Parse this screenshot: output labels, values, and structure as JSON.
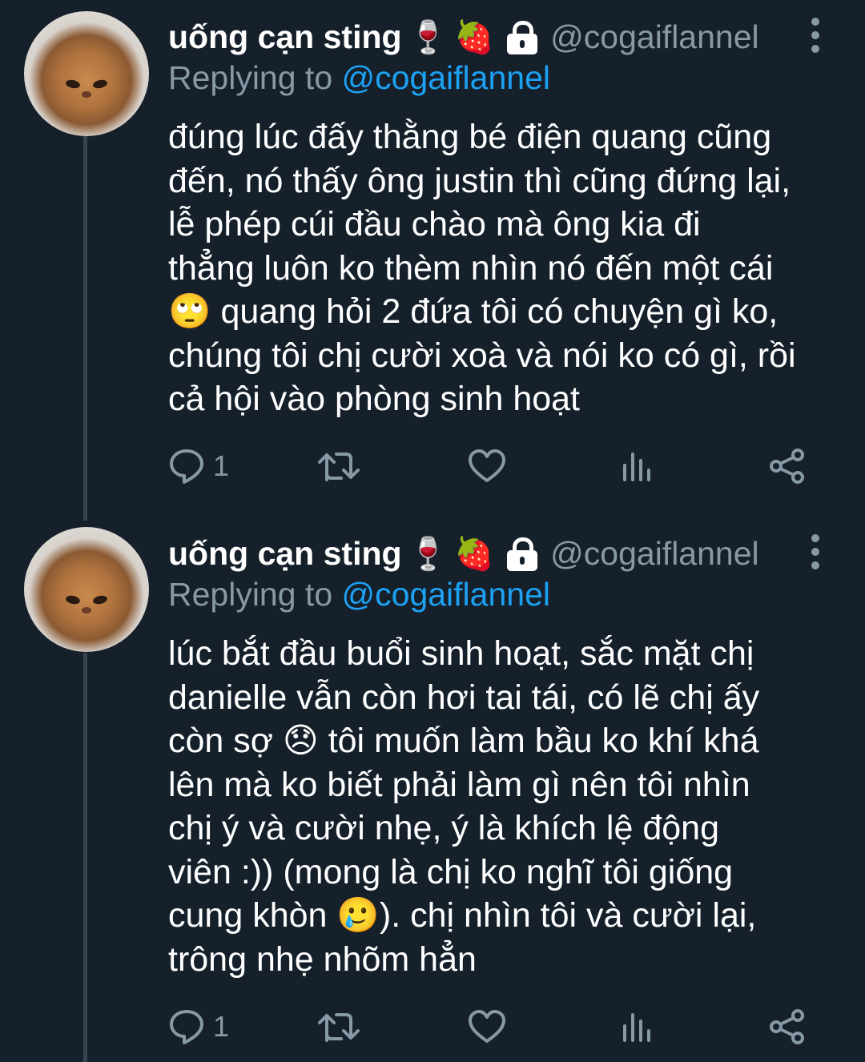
{
  "tweets": [
    {
      "display_name": "uống cạn sting",
      "name_emojis": [
        "🍷",
        "🍓"
      ],
      "handle": "@cogaiflannel",
      "replying_prefix": "Replying to",
      "replying_to": "@cogaiflannel",
      "text": "đúng lúc đấy thằng bé điện quang cũng\nđến, nó thấy ông justin thì cũng đứng lại,\nlễ phép cúi đầu chào mà ông kia đi\nthẳng luôn ko thèm nhìn nó đến một cái\n🙄 quang hỏi 2 đứa tôi có chuyện gì ko,\nchúng tôi chị cười xoà và nói ko có gì, rồi\ncả hội vào phòng sinh hoạt",
      "reply_count": "1"
    },
    {
      "display_name": "uống cạn sting",
      "name_emojis": [
        "🍷",
        "🍓"
      ],
      "handle": "@cogaiflannel",
      "replying_prefix": "Replying to",
      "replying_to": "@cogaiflannel",
      "text": "lúc bắt đầu buổi sinh hoạt, sắc mặt chị\ndanielle vẫn còn hơi tai tái, có lẽ chị ấy\ncòn sợ 😞 tôi muốn làm bầu ko khí khá\nlên mà ko biết phải làm gì nên tôi nhìn\nchị ý và cười nhẹ, ý là khích lệ động\nviên :)) (mong là chị ko nghĩ tôi giống\ncung khòn 🥲). chị nhìn tôi và cười lại,\ntrông nhẹ nhõm hẳn",
      "reply_count": "1"
    }
  ],
  "icons": {
    "reply": "reply-icon",
    "retweet": "retweet-icon",
    "like": "heart-icon",
    "analytics": "analytics-icon",
    "share": "share-icon",
    "protected": "lock-icon",
    "more": "more-icon"
  },
  "colors": {
    "background": "#15202b",
    "text": "#ffffff",
    "secondary": "#8899a6",
    "mention": "#1da1f2",
    "thread_line": "#38444d"
  }
}
